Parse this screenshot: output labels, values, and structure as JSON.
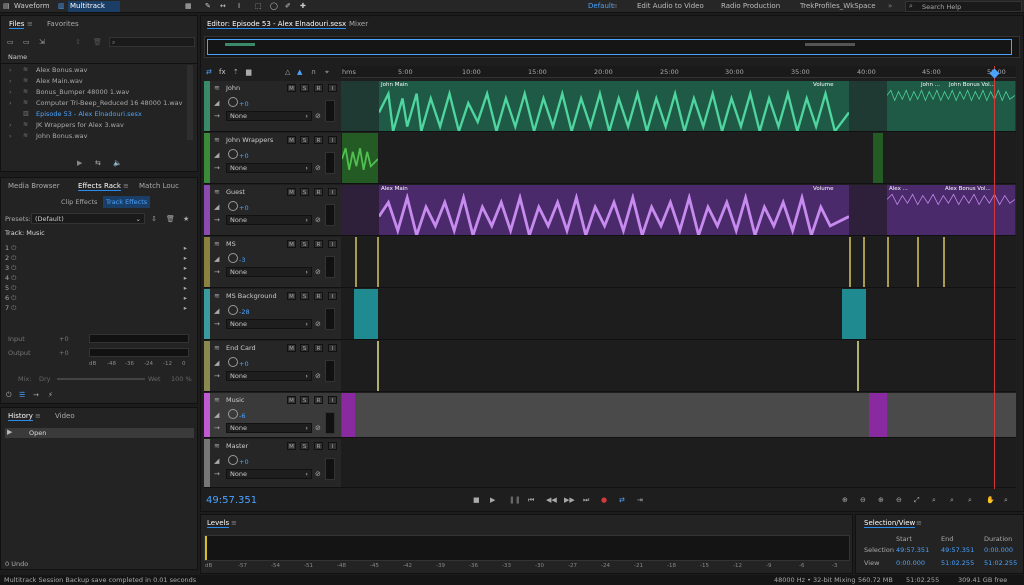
{
  "topbar": {
    "waveform": "Waveform",
    "multitrack": "Multitrack",
    "workspaces": [
      "Default",
      "Edit Audio to Video",
      "Radio Production",
      "TrekProfiles_WkSpace"
    ],
    "search_placeholder": "Search Help"
  },
  "files": {
    "tab": "Files",
    "tab2": "Favorites",
    "col": "Name",
    "items": [
      "Alex Bonus.wav",
      "Alex Main.wav",
      "Bonus_Bumper 48000 1.wav",
      "Computer Tri-Beep_Reduced 16 48000 1.wav",
      "Episode 53 - Alex Elnadouri.sesx",
      "JK Wrappers for Alex 3.wav",
      "John Bonus.wav"
    ]
  },
  "effects": {
    "tabs": [
      "Media Browser",
      "Effects Rack",
      "Match Louc"
    ],
    "subtabs": [
      "Clip Effects",
      "Track Effects"
    ],
    "presets_label": "Presets:",
    "preset": "(Default)",
    "track_label": "Track: Music",
    "slots": [
      "1",
      "2",
      "3",
      "4",
      "5",
      "6",
      "7"
    ],
    "input": "Input",
    "output": "Output",
    "in_val": "+0",
    "out_val": "+0",
    "mix": "Mix:",
    "dry": "Dry",
    "wet": "Wet",
    "pct": "100 %",
    "db_ticks": [
      "dB",
      "-48",
      "-36",
      "-24",
      "-12",
      "0"
    ]
  },
  "history": {
    "tabs": [
      "History",
      "Video"
    ],
    "items": [
      "Open"
    ],
    "undo": "0 Undo"
  },
  "editor": {
    "tab": "Editor: Episode 53 - Alex Elnadouri.sesx",
    "mixer": "Mixer",
    "timecode": "49:57.351",
    "ruler": [
      "hms",
      "5:00",
      "10:00",
      "15:00",
      "20:00",
      "25:00",
      "30:00",
      "35:00",
      "40:00",
      "45:00",
      "50:00"
    ]
  },
  "tracks": [
    {
      "name": "John",
      "vol": "+0",
      "route": "None",
      "color": "#3a8a6a"
    },
    {
      "name": "John Wrappers",
      "vol": "+0",
      "route": "None",
      "color": "#3a8a3a"
    },
    {
      "name": "Guest",
      "vol": "+0",
      "route": "None",
      "color": "#8a4ab0"
    },
    {
      "name": "MS",
      "vol": "-3",
      "route": "None",
      "color": "#8a8040"
    },
    {
      "name": "MS Background",
      "vol": "-28",
      "route": "None",
      "color": "#3a9aa0"
    },
    {
      "name": "End Card",
      "vol": "+0",
      "route": "None",
      "color": "#8a8a50"
    },
    {
      "name": "Music",
      "vol": "-6",
      "route": "None",
      "color": "#c05ad0"
    },
    {
      "name": "Master",
      "vol": "+0",
      "route": "None",
      "color": "#777"
    }
  ],
  "clips": {
    "john_main": "John Main",
    "alex_main": "Alex Main",
    "volume": "Volume",
    "john_s": "John ...",
    "john_bonus": "John Bonus Vol...",
    "alex_s": "Alex ...",
    "alex_bonus": "Alex Bonus Vol..."
  },
  "levels": {
    "title": "Levels",
    "ticks": [
      "dB",
      "-57",
      "-54",
      "-51",
      "-48",
      "-45",
      "-42",
      "-39",
      "-36",
      "-33",
      "-30",
      "-27",
      "-24",
      "-21",
      "-18",
      "-15",
      "-12",
      "-9",
      "-6",
      "-3",
      "0"
    ]
  },
  "selection": {
    "title": "Selection/View",
    "cols": [
      "Start",
      "End",
      "Duration"
    ],
    "sel_label": "Selection",
    "view_label": "View",
    "sel": [
      "49:57.351",
      "49:57.351",
      "0:00.000"
    ],
    "view": [
      "0:00.000",
      "51:02.255",
      "51:02.255"
    ]
  },
  "status": {
    "msg": "Multitrack Session Backup save completed in 0.01 seconds",
    "rate": "48000 Hz • 32-bit Mixing",
    "mem": "560.72 MB",
    "dur": "51:02.255",
    "free": "309.41 GB free"
  }
}
